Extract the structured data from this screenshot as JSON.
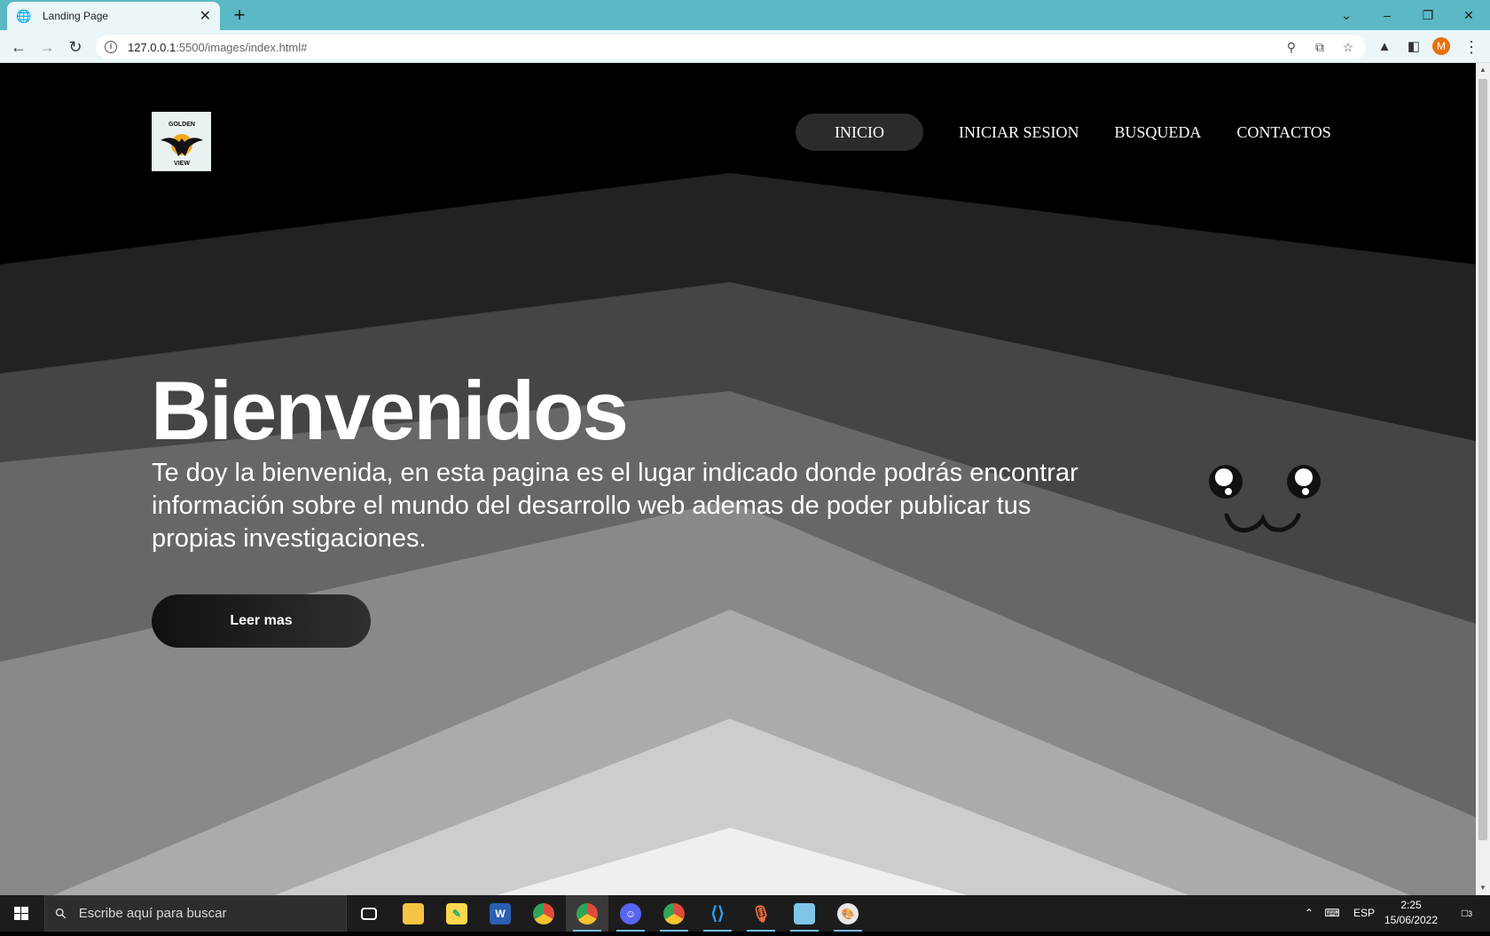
{
  "browser": {
    "tab_title": "Landing Page",
    "tab_close": "✕",
    "new_tab": "+",
    "url_host": "127.0.0.1",
    "url_rest": ":5500/images/index.html#",
    "avatar_letter": "M"
  },
  "site": {
    "logo_text_top": "GOLDEN",
    "logo_text_bottom": "VIEW",
    "nav": [
      {
        "label": "INICIO",
        "active": true
      },
      {
        "label": "INICIAR SESION",
        "active": false
      },
      {
        "label": "BUSQUEDA",
        "active": false
      },
      {
        "label": "CONTACTOS",
        "active": false
      }
    ],
    "hero_title": "Bienvenidos",
    "hero_text": "Te doy la bienvenida, en esta pagina es el lugar indicado donde podrás encontrar información sobre el mundo del desarrollo web ademas de poder publicar tus propias investigaciones.",
    "cta_label": "Leer mas"
  },
  "taskbar": {
    "search_placeholder": "Escribe aquí para buscar",
    "lang": "ESP",
    "time": "2:25",
    "date": "15/06/2022",
    "notifications": "3"
  },
  "colors": {
    "tabbar": "#5bb8c4",
    "toolbar": "#eaf6f8",
    "bands": [
      "#000000",
      "#222222",
      "#454545",
      "#676767",
      "#898989",
      "#ababab",
      "#cdcdcd",
      "#efefef"
    ]
  }
}
